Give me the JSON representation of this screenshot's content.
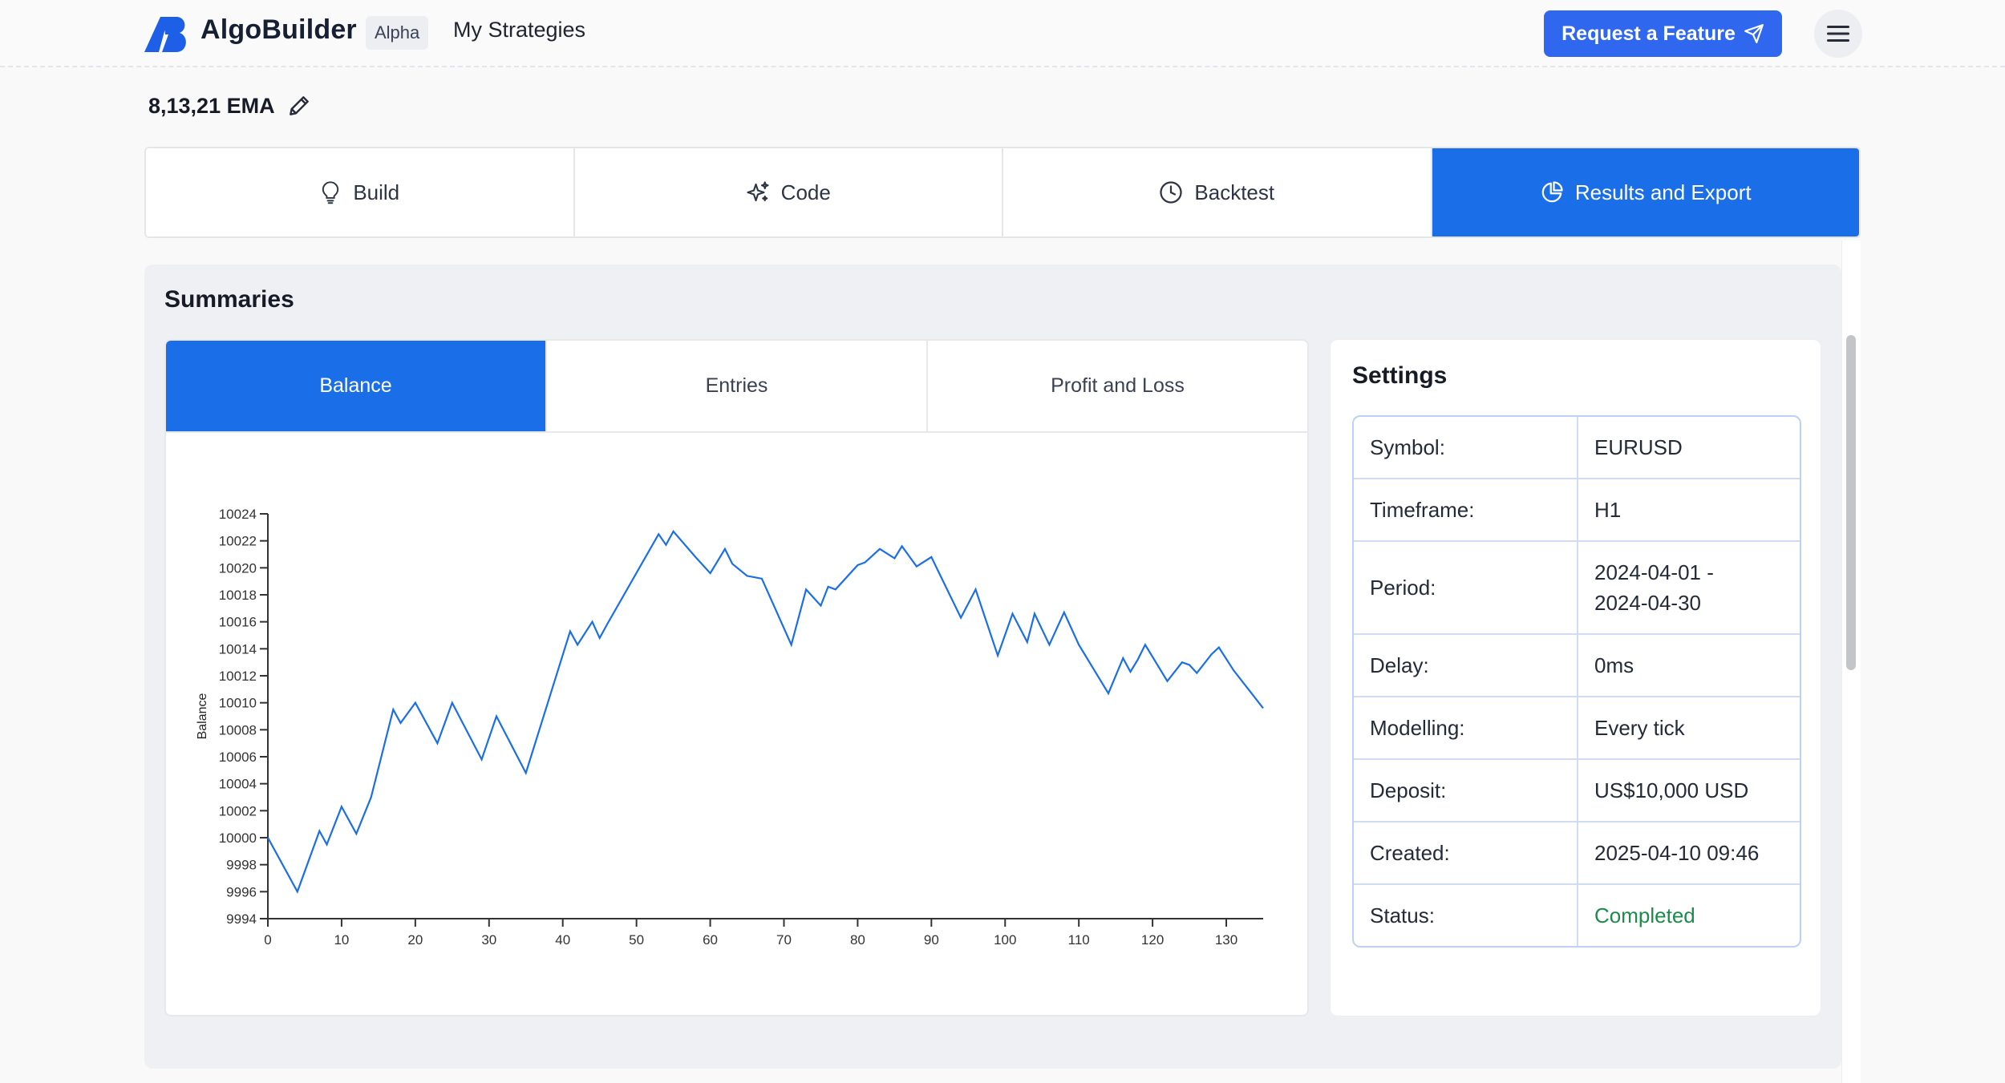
{
  "header": {
    "brand": "AlgoBuilder",
    "badge": "Alpha",
    "nav_link": "My Strategies",
    "request_button": "Request a Feature",
    "brand_color": "#2f67ee"
  },
  "strategy": {
    "name": "8,13,21 EMA"
  },
  "main_tabs": [
    {
      "label": "Build",
      "icon": "lightbulb-icon"
    },
    {
      "label": "Code",
      "icon": "sparkles-icon"
    },
    {
      "label": "Backtest",
      "icon": "clock-icon"
    },
    {
      "label": "Results and Export",
      "icon": "pie-chart-icon",
      "active": true
    }
  ],
  "summaries": {
    "title": "Summaries",
    "tabs": [
      {
        "label": "Balance",
        "active": true
      },
      {
        "label": "Entries"
      },
      {
        "label": "Profit and Loss"
      }
    ]
  },
  "settings": {
    "title": "Settings",
    "rows": [
      {
        "key": "Symbol:",
        "value": "EURUSD"
      },
      {
        "key": "Timeframe:",
        "value": "H1"
      },
      {
        "key": "Period:",
        "value": "2024-04-01 -\n2024-04-30"
      },
      {
        "key": "Delay:",
        "value": "0ms"
      },
      {
        "key": "Modelling:",
        "value": "Every tick"
      },
      {
        "key": "Deposit:",
        "value": "US$10,000 USD"
      },
      {
        "key": "Created:",
        "value": "2025-04-10 09:46"
      },
      {
        "key": "Status:",
        "value": "Completed",
        "status_color": "#1c8b4b"
      }
    ]
  },
  "chart_data": {
    "type": "line",
    "title": "",
    "xlabel": "",
    "ylabel": "Balance",
    "xlim": [
      0,
      135
    ],
    "ylim": [
      9994,
      10024
    ],
    "x_ticks": [
      0,
      10,
      20,
      30,
      40,
      50,
      60,
      70,
      80,
      90,
      100,
      110,
      120,
      130
    ],
    "y_ticks": [
      9994,
      9996,
      9998,
      10000,
      10002,
      10004,
      10006,
      10008,
      10010,
      10012,
      10014,
      10016,
      10018,
      10020,
      10022,
      10024
    ],
    "grid": false,
    "line_color": "#1a6fe8",
    "series": [
      {
        "x": [
          0,
          4,
          7,
          8,
          10,
          12,
          14,
          17,
          18,
          20,
          23,
          25,
          29,
          31,
          35,
          41,
          42,
          44,
          45,
          46,
          53,
          54,
          55,
          58,
          60,
          62,
          63,
          65,
          67,
          71,
          73,
          75,
          76,
          77,
          80,
          81,
          83,
          85,
          86,
          88,
          90,
          94,
          96,
          99,
          101,
          103,
          104,
          106,
          108,
          110,
          114,
          116,
          117,
          118,
          119,
          122,
          124,
          125,
          126,
          128,
          129,
          131,
          135
        ],
        "y": [
          10000,
          9996,
          10000.5,
          9999.5,
          10002.3,
          10000.3,
          10003,
          10009.5,
          10008.5,
          10010,
          10007,
          10010,
          10005.8,
          10009,
          10004.8,
          10015.3,
          10014.3,
          10016,
          10014.8,
          10015.8,
          10022.5,
          10021.7,
          10022.7,
          10020.8,
          10019.6,
          10021.4,
          10020.3,
          10019.4,
          10019.2,
          10014.3,
          10018.4,
          10017.2,
          10018.6,
          10018.4,
          10020.2,
          10020.4,
          10021.4,
          10020.7,
          10021.6,
          10020.1,
          10020.8,
          10016.3,
          10018.4,
          10013.5,
          10016.6,
          10014.5,
          10016.6,
          10014.3,
          10016.7,
          10014.3,
          10010.7,
          10013.3,
          10012.3,
          10013.2,
          10014.3,
          10011.6,
          10013.0,
          10012.8,
          10012.2,
          10013.6,
          10014.1,
          10012.4,
          10009.6
        ]
      }
    ]
  }
}
